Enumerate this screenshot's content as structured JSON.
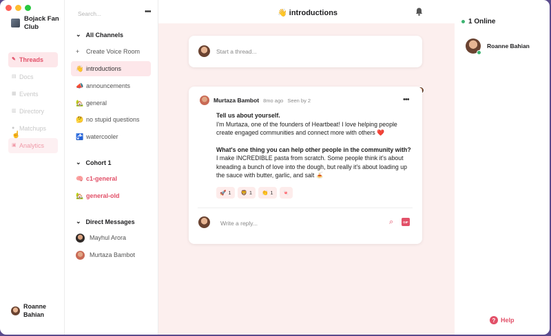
{
  "club": {
    "name": "Bojack Fan Club"
  },
  "search": {
    "placeholder": "Search..."
  },
  "nav": {
    "items": [
      {
        "label": "Threads",
        "icon": "pen-icon"
      },
      {
        "label": "Docs",
        "icon": "document-icon"
      },
      {
        "label": "Events",
        "icon": "calendar-icon"
      },
      {
        "label": "Directory",
        "icon": "directory-icon"
      },
      {
        "label": "Matchups",
        "icon": "matchups-icon"
      },
      {
        "label": "Analytics",
        "icon": "analytics-icon"
      }
    ]
  },
  "current_user": {
    "name": "Roanne Bahian"
  },
  "channels": {
    "all_label": "All Channels",
    "create_voice": "Create Voice Room",
    "list": [
      {
        "emoji": "👋",
        "name": "introductions"
      },
      {
        "emoji": "📣",
        "name": "announcements"
      },
      {
        "emoji": "🏡",
        "name": "general"
      },
      {
        "emoji": "🤔",
        "name": "no stupid questions"
      },
      {
        "emoji": "🚰",
        "name": "watercooler"
      }
    ],
    "cohort_label": "Cohort 1",
    "cohort_list": [
      {
        "emoji": "🧠",
        "name": "c1-general"
      },
      {
        "emoji": "🏡",
        "name": "general-old"
      }
    ],
    "dm_label": "Direct Messages",
    "dms": [
      {
        "name": "Mayhul Arora"
      },
      {
        "name": "Murtaza Bambot"
      }
    ]
  },
  "header": {
    "emoji": "👋",
    "title": "introductions"
  },
  "composer": {
    "placeholder": "Start a thread..."
  },
  "thread": {
    "author": "Murtaza Bambot",
    "time": "8mo ago",
    "seen": "Seen by 2",
    "q1": "Tell us about yourself.",
    "a1": "I'm Murtaza, one of the founders of Heartbeat! I love helping people create engaged communities and connect more with others ❤️",
    "q2": "What's one thing you can help other people in the community with?",
    "a2": "I make INCREDIBLE pasta from scratch. Some people think it's about kneading a bunch of love into the dough, but really it's about loading up the sauce with butter, garlic, and salt 🍝",
    "reactions": [
      {
        "emoji": "🚀",
        "count": "1"
      },
      {
        "emoji": "🦁",
        "count": "1"
      },
      {
        "emoji": "👏",
        "count": "1"
      },
      {
        "emoji": "🍬",
        "count": ""
      }
    ],
    "reply_placeholder": "Write a reply...",
    "gif_label": "GIF"
  },
  "online": {
    "label": "1 Online",
    "members": [
      {
        "name": "Roanne Bahian"
      }
    ]
  },
  "help": {
    "label": "Help",
    "icon": "?"
  },
  "colors": {
    "accent": "#e25068",
    "main_bg": "#fcefee",
    "online": "#3cb371"
  }
}
